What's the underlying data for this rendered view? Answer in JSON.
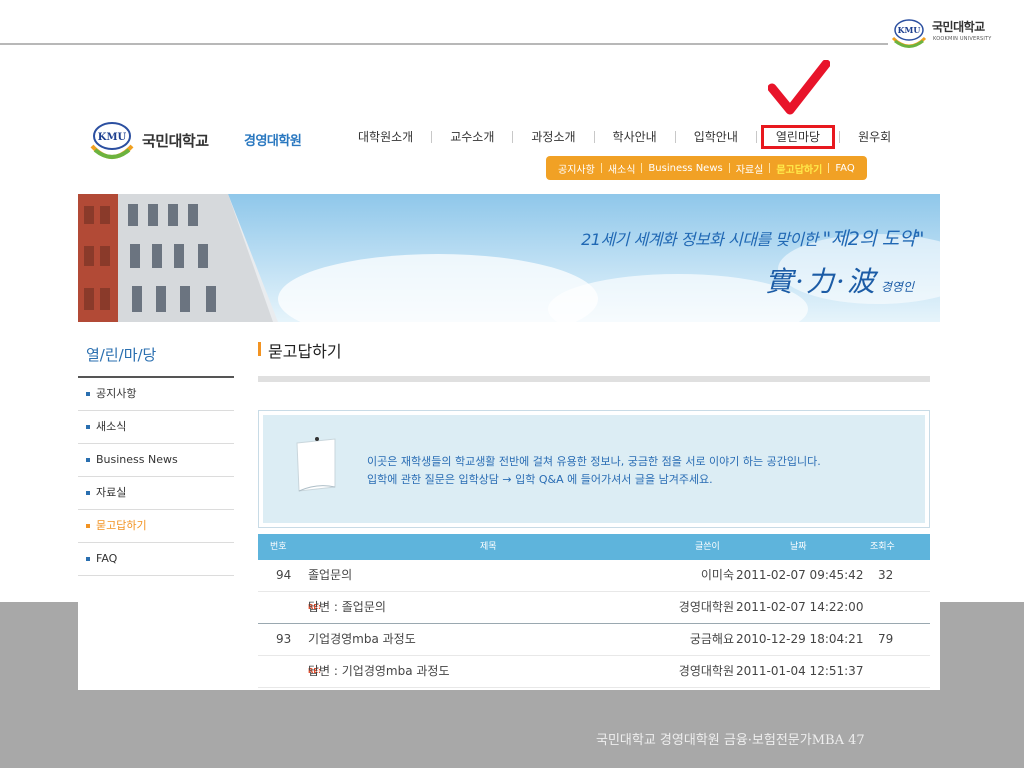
{
  "corner": {
    "emblem_text": "KMU",
    "name": "국민대학교",
    "sub": "KOOKMIN UNIVERSITY"
  },
  "header": {
    "logo_emblem": "KMU",
    "logo_university": "국민대학교",
    "logo_school": "경영대학원"
  },
  "gnb": {
    "items": [
      "대학원소개",
      "교수소개",
      "과정소개",
      "학사안내",
      "입학안내",
      "열린마당",
      "원우회"
    ],
    "active_index": 5
  },
  "subnav": {
    "items": [
      "공지사항",
      "새소식",
      "Business News",
      "자료실",
      "묻고답하기",
      "FAQ"
    ],
    "active_index": 4
  },
  "banner": {
    "slogan_line1_pre": "21세기 세계화 정보화 시대를 맞이한 ",
    "slogan_line1_quote": "\"제2의 도약\"",
    "slogan_hanja": "實·力·波",
    "slogan_who": "경영인"
  },
  "lnb": {
    "title": "열/린/마/당",
    "items": [
      "공지사항",
      "새소식",
      "Business News",
      "자료실",
      "묻고답하기",
      "FAQ"
    ],
    "active_index": 4
  },
  "content": {
    "title": "묻고답하기",
    "notice_line1": "이곳은 재학생들의 학교생활 전반에 걸쳐 유용한 정보나, 궁금한 점을 서로 이야기 하는 공간입니다.",
    "notice_line2": "입학에 관한 질문은 입학상담 → 입학 Q&A 에 들어가셔서 글을 남겨주세요."
  },
  "board": {
    "columns": [
      "번호",
      "제목",
      "글쓴이",
      "날짜",
      "조회수"
    ],
    "re_badge": "RE:",
    "rows": [
      {
        "no": "94",
        "title": "졸업문의",
        "writer": "이미숙",
        "date": "2011-02-07 09:45:42",
        "views": "32",
        "reply": false
      },
      {
        "no": "",
        "title": "답변 : 졸업문의",
        "writer": "경영대학원",
        "date": "2011-02-07 14:22:00",
        "views": "",
        "reply": true
      },
      {
        "no": "93",
        "title": "기업경영mba 과정도",
        "writer": "궁금해요",
        "date": "2010-12-29 18:04:21",
        "views": "79",
        "reply": false
      },
      {
        "no": "",
        "title": "답변 : 기업경영mba 과정도",
        "writer": "경영대학원",
        "date": "2011-01-04 12:51:37",
        "views": "",
        "reply": true
      }
    ]
  },
  "footer": {
    "text": "국민대학교 경영대학원 금융·보험전문가MBA 47"
  },
  "colors": {
    "highlight_box": "#e8181e",
    "checkmark": "#e8142a",
    "subnav_bg": "#f1a125",
    "board_head": "#5eb4dc",
    "accent_orange": "#f29322",
    "link_blue": "#2a6fb0"
  }
}
